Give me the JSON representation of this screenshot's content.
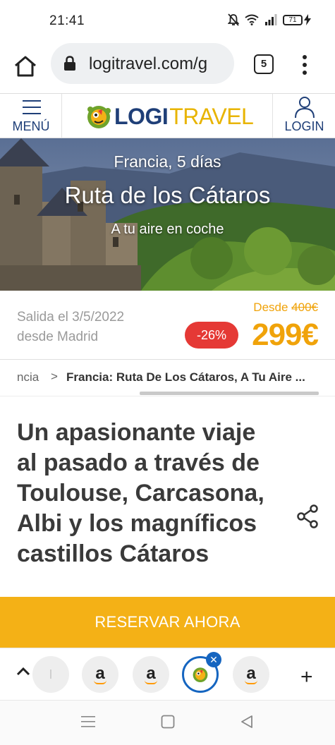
{
  "status_bar": {
    "time": "21:41",
    "battery": "71",
    "icons": [
      "mute-icon",
      "wifi-icon",
      "signal-icon",
      "battery-icon",
      "charging-icon"
    ]
  },
  "browser": {
    "url": "logitravel.com/g",
    "tab_count": "5",
    "icons": [
      "home-icon",
      "lock-icon",
      "overflow-icon"
    ]
  },
  "site_header": {
    "menu_label": "MENÚ",
    "logo_logi": "LOGI",
    "logo_travel": "TRAVEL",
    "login_label": "LOGIN"
  },
  "hero": {
    "subtitle": "Francia, 5 días",
    "title": "Ruta de los Cátaros",
    "tagline": "A tu aire en coche"
  },
  "booking": {
    "departure_line1": "Salida el 3/5/2022",
    "departure_line2": "desde Madrid",
    "desde_label": "Desde",
    "old_price": "400€",
    "discount": "-26%",
    "price": "299€"
  },
  "breadcrumb": {
    "previous": "ncia",
    "separator": ">",
    "current": "Francia: Ruta De Los Cátaros, A Tu Aire ..."
  },
  "headline": "Un apasionante viaje al pasado a través de Toulouse, Carcasona, Albi y los magníficos castillos Cátaros",
  "cta_label": "RESERVAR AHORA",
  "tab_switcher": {
    "tabs": [
      {
        "label": "a",
        "icon": "amazon-icon"
      },
      {
        "label": "a",
        "icon": "amazon-icon"
      },
      {
        "label": "",
        "icon": "logitravel-icon",
        "active": true
      },
      {
        "label": "a",
        "icon": "amazon-icon"
      }
    ],
    "plus": "+"
  },
  "colors": {
    "brand_blue": "#1f3f78",
    "brand_yellow": "#f4b116",
    "price_orange": "#f0a30a",
    "discount_red": "#e53935",
    "active_tab_blue": "#1565c0"
  }
}
